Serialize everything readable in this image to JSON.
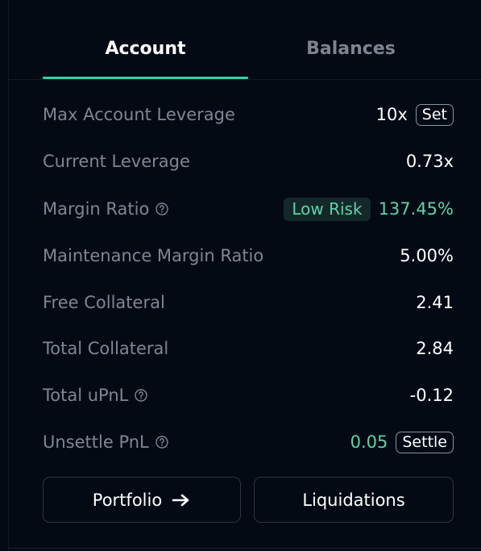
{
  "tabs": [
    {
      "label": "Account",
      "active": true
    },
    {
      "label": "Balances",
      "active": false
    }
  ],
  "rows": {
    "max_leverage": {
      "label": "Max Account Leverage",
      "value": "10x",
      "button": "Set"
    },
    "current_leverage": {
      "label": "Current Leverage",
      "value": "0.73x"
    },
    "margin_ratio": {
      "label": "Margin Ratio",
      "badge": "Low Risk",
      "value": "137.45%"
    },
    "maintenance_margin": {
      "label": "Maintenance Margin Ratio",
      "value": "5.00%"
    },
    "free_collateral": {
      "label": "Free Collateral",
      "value": "2.41"
    },
    "total_collateral": {
      "label": "Total Collateral",
      "value": "2.84"
    },
    "total_upnl": {
      "label": "Total uPnL",
      "value": "-0.12"
    },
    "unsettle_pnl": {
      "label": "Unsettle PnL",
      "value": "0.05",
      "button": "Settle"
    }
  },
  "buttons": {
    "portfolio": "Portfolio",
    "liquidations": "Liquidations"
  },
  "icons": {
    "help": "help-circle-icon",
    "arrow": "arrow-right-icon"
  },
  "colors": {
    "background": "#030a14",
    "accent": "#34d1a2",
    "positive": "#5fd3a6",
    "label": "#7d8793"
  }
}
